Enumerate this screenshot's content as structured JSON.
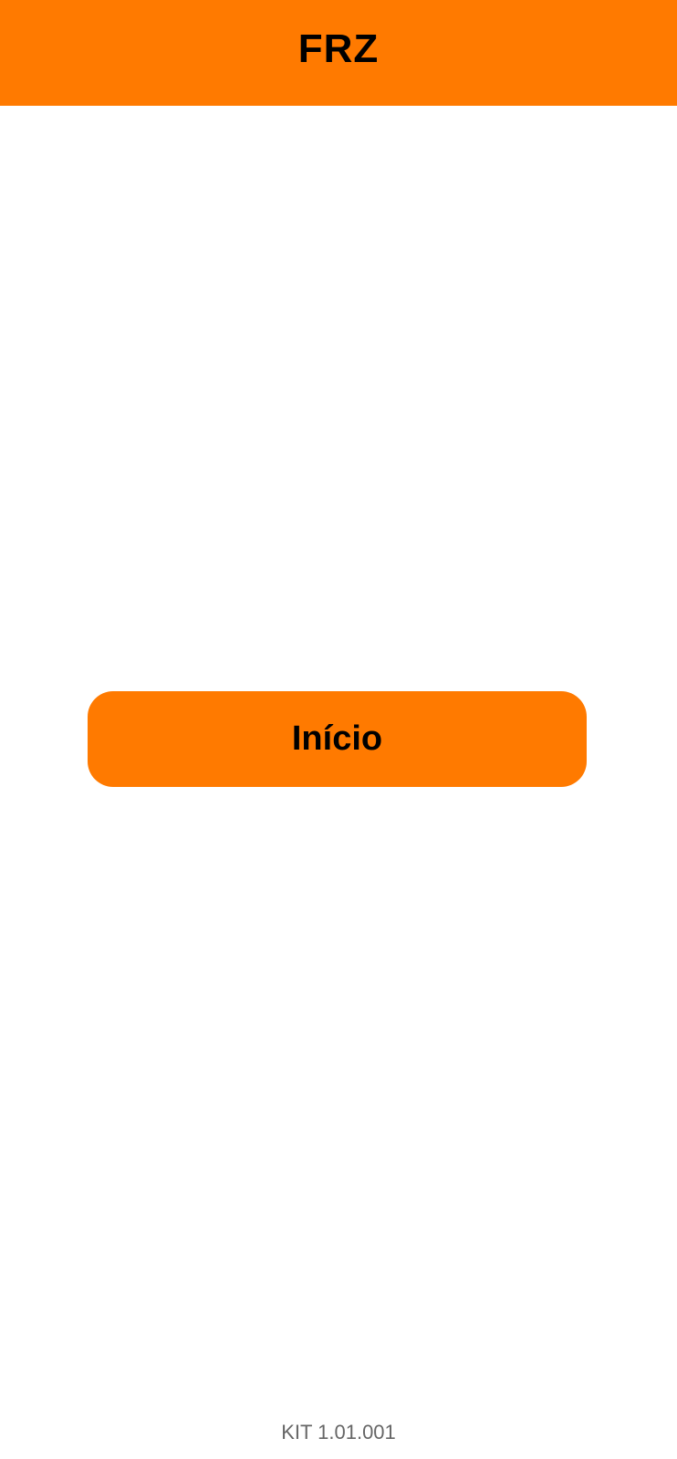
{
  "colors": {
    "accent": "#FF7A00",
    "background": "#FFFFFF",
    "text_primary": "#000000",
    "text_secondary": "#666666"
  },
  "header": {
    "title": "FRZ"
  },
  "main": {
    "start_button_label": "Início"
  },
  "footer": {
    "version": "KIT 1.01.001"
  }
}
